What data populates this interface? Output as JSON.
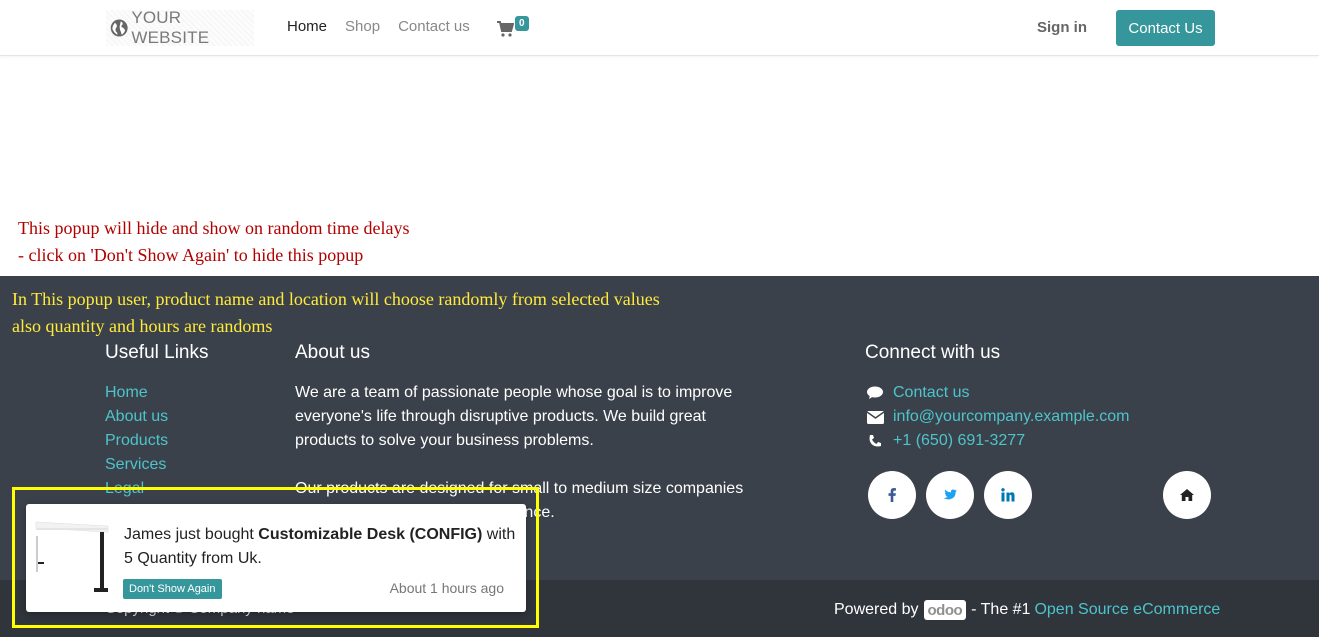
{
  "header": {
    "logo_text": "YOUR WEBSITE",
    "nav": [
      "Home",
      "Shop",
      "Contact us"
    ],
    "cart_count": "0",
    "signin": "Sign in",
    "contact_button": "Contact Us"
  },
  "notes": {
    "red_line1": "This popup will hide and show on random time delays",
    "red_line2": "- click on 'Don't Show Again' to hide this popup",
    "yellow_line1": "In This  popup user, product name and location will choose randomly from selected values",
    "yellow_line2": "also quantity and hours are randoms"
  },
  "footer": {
    "useful_links_title": "Useful Links",
    "useful_links": [
      "Home",
      "About us",
      "Products",
      "Services",
      "Legal"
    ],
    "about_title": "About us",
    "about_p1": "We are a team of passionate people whose goal is to improve everyone's life through disruptive products. We build great products to solve your business problems.",
    "about_p2": "Our products are designed for small to medium size companies willing to optimize their performance.",
    "connect_title": "Connect with us",
    "connect_items": [
      "Contact us",
      "info@yourcompany.example.com",
      "+1 (650) 691-3277"
    ],
    "copyright": "Copyright © Company name",
    "powered_by": "Powered by",
    "odoo": "odoo",
    "the_number_one": "- The #1",
    "open_source_link": "Open Source eCommerce"
  },
  "popup": {
    "user_text": "James just bought ",
    "product": "Customizable Desk (CONFIG)",
    "after_product": " with",
    "quantity_line": "5 Quantity from Uk.",
    "dont_show_label": "Don't Show Again",
    "time_label": "About 1 hours ago"
  },
  "colors": {
    "accent": "#35979c",
    "link": "#4dc4cb",
    "footer_bg": "#3b414a",
    "highlight": "#ffff00"
  }
}
